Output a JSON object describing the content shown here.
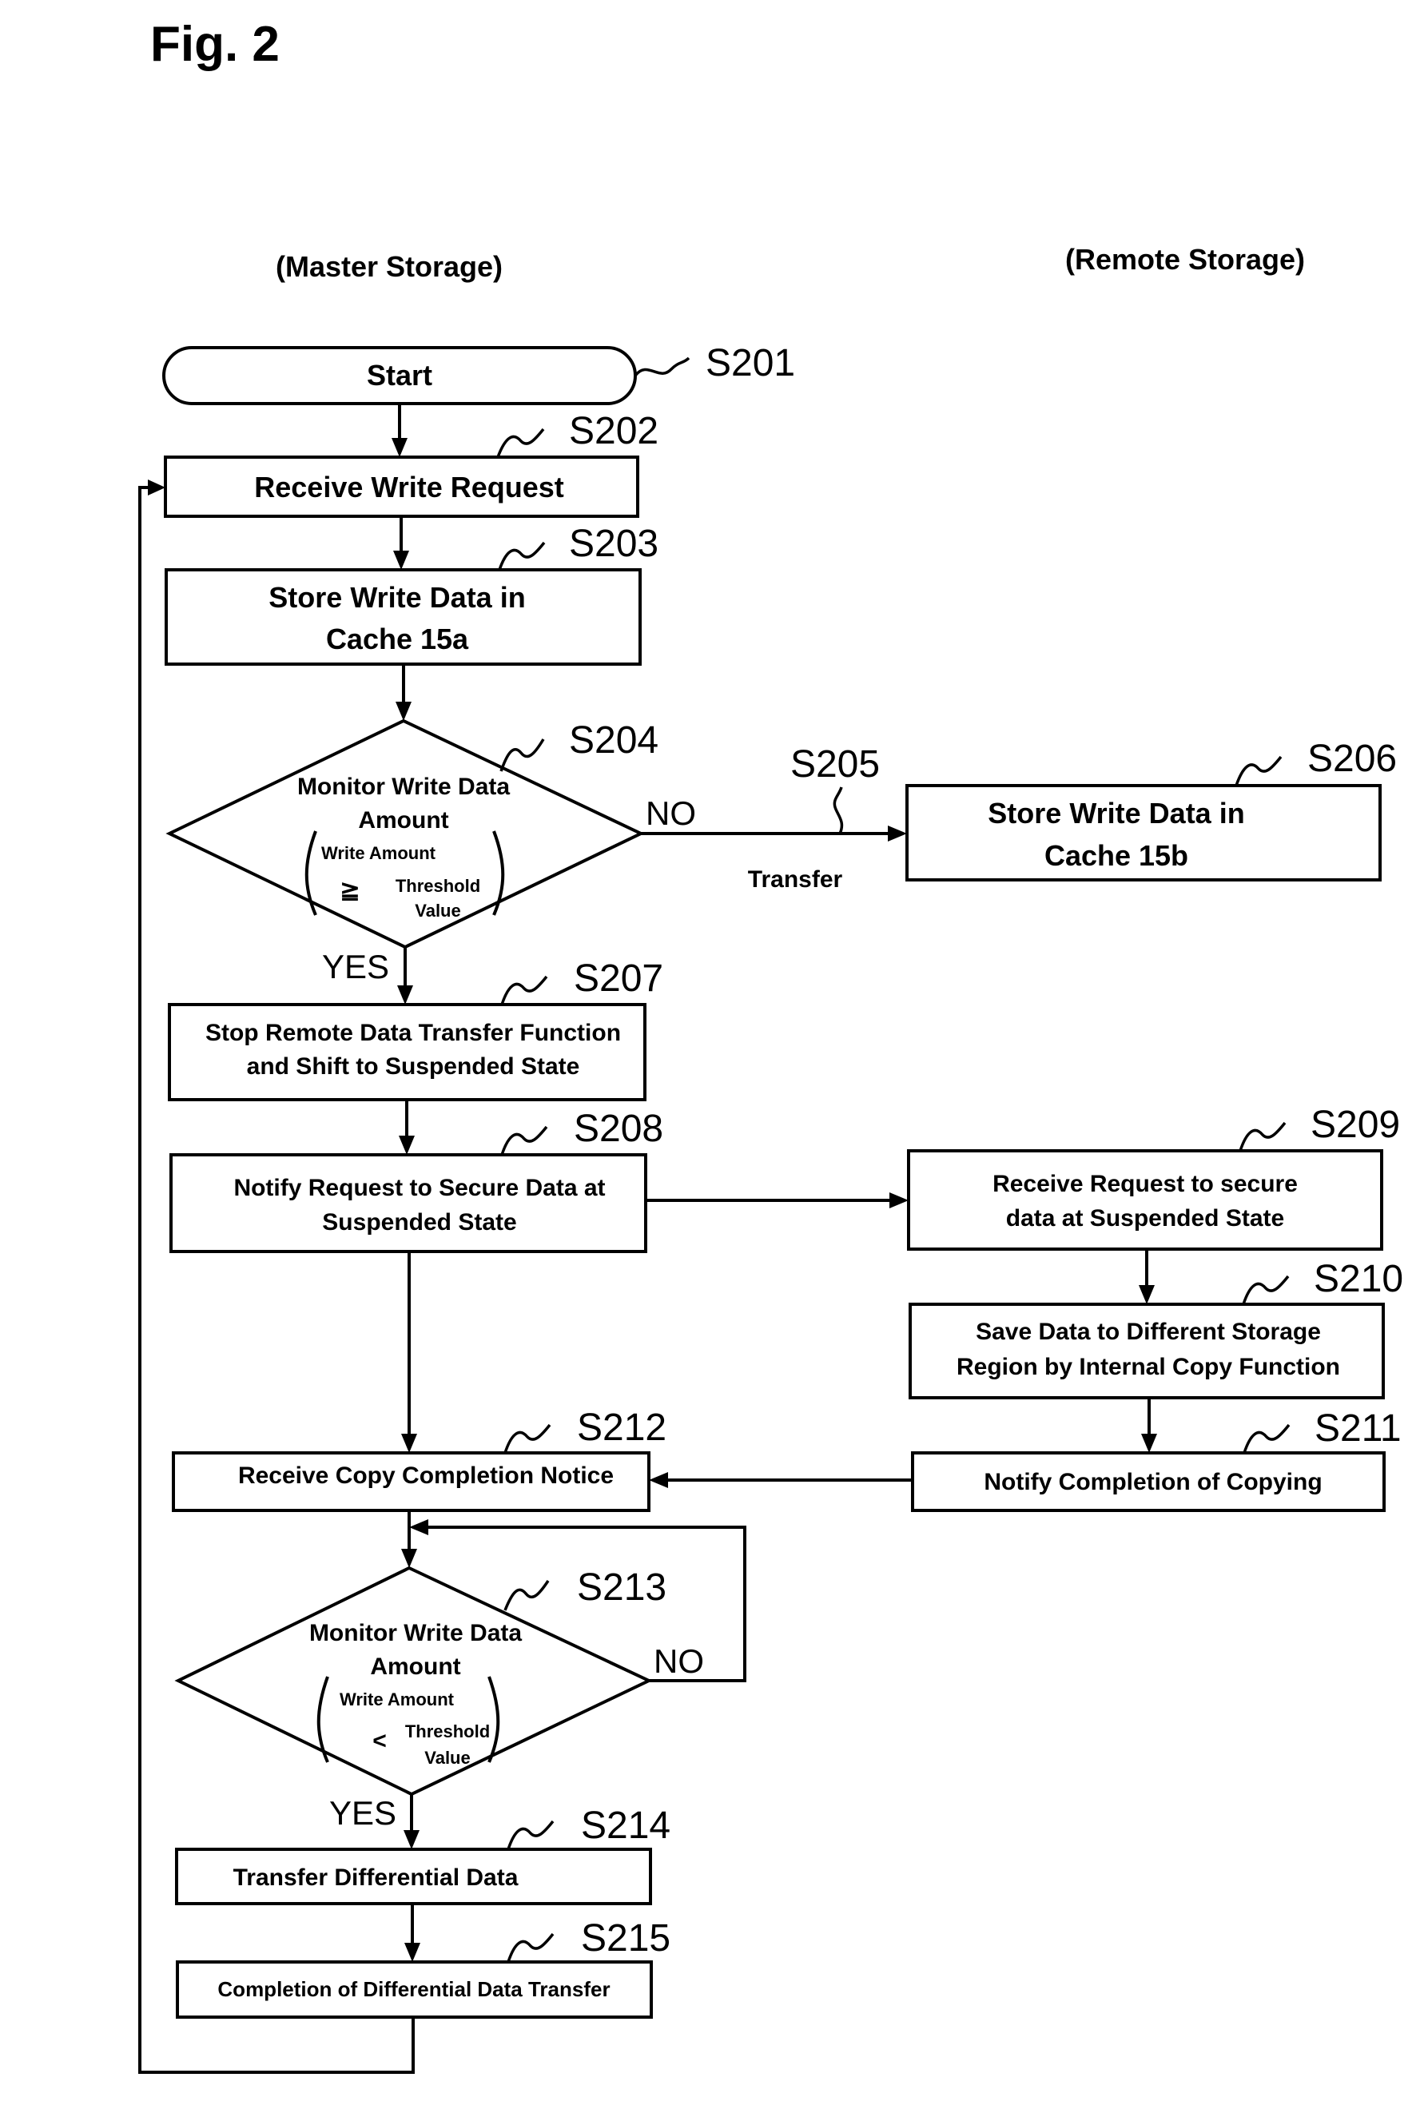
{
  "figure": {
    "title": "Fig. 2",
    "lanes": {
      "master": "(Master Storage)",
      "remote": "(Remote Storage)"
    }
  },
  "steps": {
    "s201": {
      "id": "S201",
      "lines": [
        "Start"
      ]
    },
    "s202": {
      "id": "S202",
      "lines": [
        "Receive Write Request"
      ]
    },
    "s203": {
      "id": "S203",
      "lines": [
        "Store Write Data in",
        "Cache 15a"
      ]
    },
    "s204": {
      "id": "S204",
      "lines": [
        "Monitor Write Data",
        "Amount"
      ],
      "condition": {
        "left": "Write Amount",
        "operator": "≧",
        "right_1": "Threshold",
        "right_2": "Value"
      },
      "yes": "YES",
      "no": "NO"
    },
    "s205": {
      "id": "S205",
      "label": "Transfer"
    },
    "s206": {
      "id": "S206",
      "lines": [
        "Store Write Data in",
        "Cache 15b"
      ]
    },
    "s207": {
      "id": "S207",
      "lines": [
        "Stop Remote Data Transfer Function",
        "and Shift to Suspended State"
      ]
    },
    "s208": {
      "id": "S208",
      "lines": [
        "Notify Request to Secure Data at",
        "Suspended State"
      ]
    },
    "s209": {
      "id": "S209",
      "lines": [
        "Receive Request to secure",
        "data at Suspended State"
      ]
    },
    "s210": {
      "id": "S210",
      "lines": [
        "Save Data to Different Storage",
        "Region by Internal Copy Function"
      ]
    },
    "s211": {
      "id": "S211",
      "lines": [
        "Notify Completion of Copying"
      ]
    },
    "s212": {
      "id": "S212",
      "lines": [
        "Receive Copy Completion Notice"
      ]
    },
    "s213": {
      "id": "S213",
      "lines": [
        "Monitor Write Data",
        "Amount"
      ],
      "condition": {
        "left": "Write Amount",
        "operator": "<",
        "right_1": "Threshold",
        "right_2": "Value"
      },
      "yes": "YES",
      "no": "NO"
    },
    "s214": {
      "id": "S214",
      "lines": [
        "Transfer Differential Data"
      ]
    },
    "s215": {
      "id": "S215",
      "lines": [
        "Completion of Differential Data Transfer"
      ]
    }
  }
}
